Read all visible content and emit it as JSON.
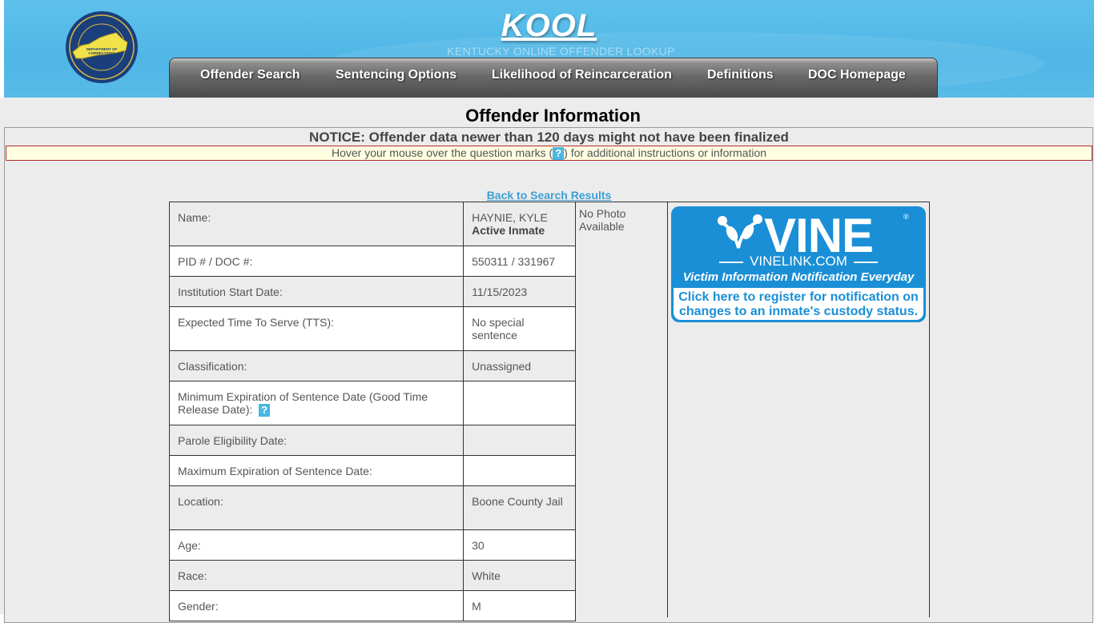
{
  "header": {
    "title": "KOOL",
    "subtitle": "KENTUCKY ONLINE OFFENDER LOOKUP",
    "seal_icon": "commonwealth-seal-icon"
  },
  "nav": [
    {
      "label": "Offender Search"
    },
    {
      "label": "Sentencing Options"
    },
    {
      "label": "Likelihood of Reincarceration"
    },
    {
      "label": "Definitions"
    },
    {
      "label": "DOC Homepage"
    }
  ],
  "page": {
    "title": "Offender Information",
    "notice": "NOTICE: Offender data newer than 120 days might not have been finalized",
    "hover_before": "Hover your mouse over the question marks (",
    "hover_q": "?",
    "hover_after": ") for additional instructions or information",
    "back_link": "Back to Search Results"
  },
  "offender": {
    "rows": [
      {
        "label": "Name:",
        "value": "HAYNIE, KYLE",
        "sub": "Active Inmate"
      },
      {
        "label": "PID # / DOC #:",
        "value": "550311 / 331967"
      },
      {
        "label": "Institution Start Date:",
        "value": "11/15/2023"
      },
      {
        "label": "Expected Time To Serve (TTS):",
        "value": "No special sentence"
      },
      {
        "label": "Classification:",
        "value": "Unassigned"
      },
      {
        "label": "Minimum Expiration of Sentence Date (Good Time Release Date):",
        "value": "",
        "help": "?"
      },
      {
        "label": "Parole Eligibility Date:",
        "value": ""
      },
      {
        "label": "Maximum Expiration of Sentence Date:",
        "value": ""
      },
      {
        "label": "Location:",
        "value": "Boone County Jail"
      },
      {
        "label": "Age:",
        "value": "30"
      },
      {
        "label": "Race:",
        "value": "White"
      },
      {
        "label": "Gender:",
        "value": "M"
      }
    ],
    "photo_text": "No Photo Available"
  },
  "vine": {
    "logo": "VINE",
    "reg": "®",
    "site": "VINELINK.COM",
    "tagline": "Victim Information Notification Everyday",
    "cta": "Click here to register for notification on changes to an inmate's custody status.",
    "color": "#1a8fd6"
  }
}
